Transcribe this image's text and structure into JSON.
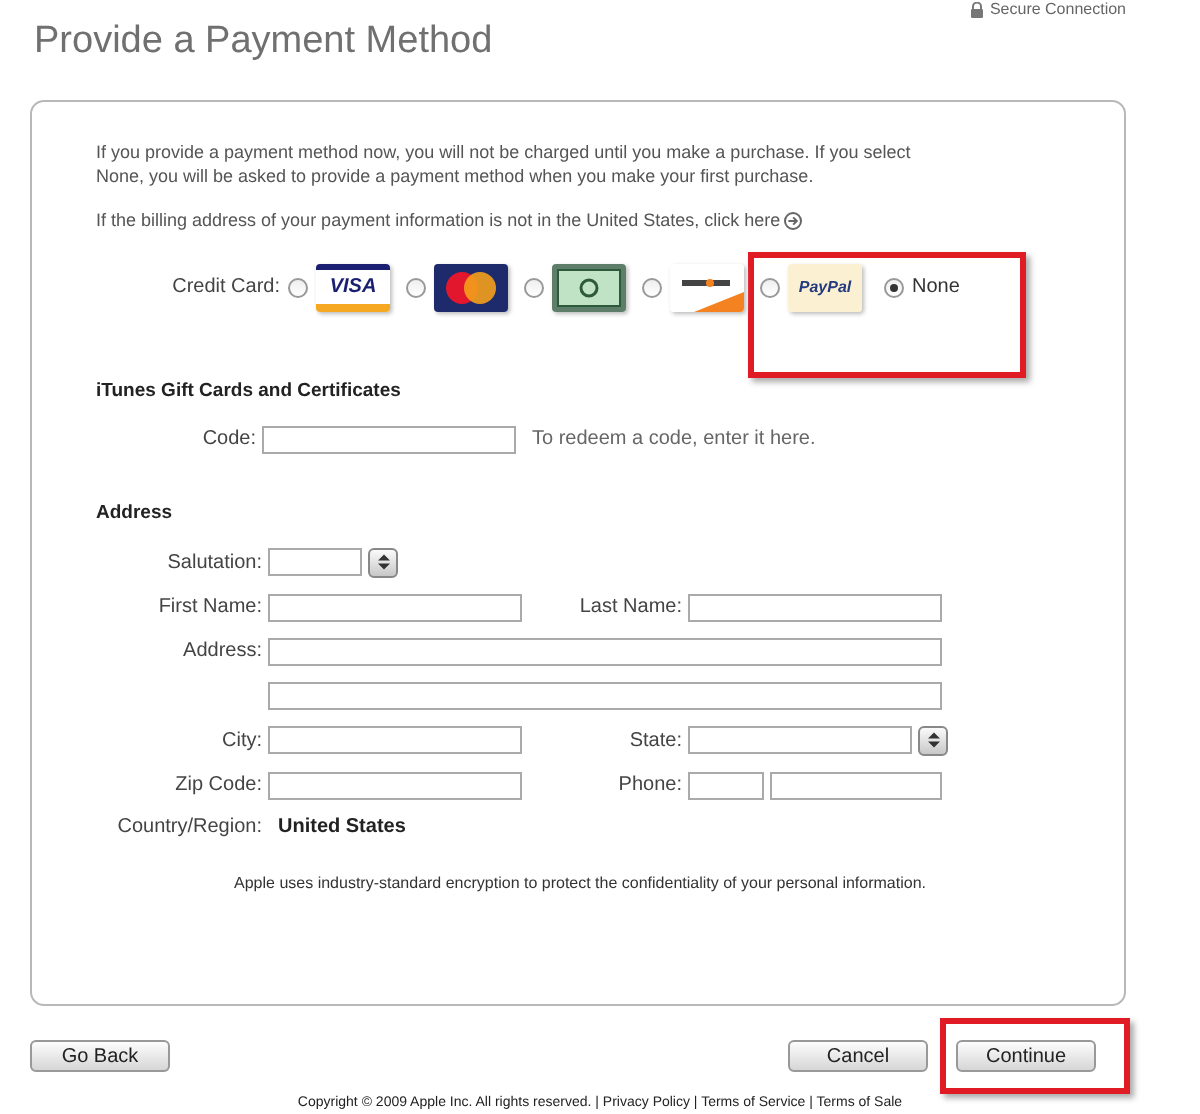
{
  "header": {
    "title": "Provide a Payment Method",
    "secure_label": "Secure Connection"
  },
  "intro": [
    "If you provide a payment method now, you will not be charged until you make a purchase. If you select None, you will be asked to provide a payment method when you make your first purchase."
  ],
  "billing_note": "If the billing address of your payment information is not in the United States, click here",
  "payment": {
    "label": "Credit Card:",
    "options": [
      {
        "kind": "visa",
        "logo_text": "VISA",
        "selected": false,
        "highlighted": false
      },
      {
        "kind": "mastercard",
        "selected": false,
        "highlighted": false
      },
      {
        "kind": "amex",
        "selected": false,
        "highlighted": false
      },
      {
        "kind": "discover",
        "selected": false,
        "highlighted": false
      },
      {
        "kind": "paypal",
        "logo_text": "PayPal",
        "selected": false,
        "highlighted": true
      },
      {
        "kind": "none",
        "label": "None",
        "selected": true,
        "highlighted": true
      }
    ]
  },
  "gift": {
    "heading": "iTunes Gift Cards and Certificates",
    "code_label": "Code:",
    "hint": "To redeem a code, enter it here."
  },
  "address": {
    "heading": "Address",
    "rows": [
      {
        "cells": [
          {
            "kind": "select",
            "label": "Salutation:"
          }
        ]
      },
      {
        "cells": [
          {
            "kind": "text",
            "label": "First Name:"
          },
          {
            "kind": "text",
            "label": "Last Name:"
          }
        ]
      },
      {
        "cells": [
          {
            "kind": "wide",
            "label": "Address:"
          }
        ]
      },
      {
        "cells": [
          {
            "kind": "wide"
          }
        ]
      },
      {
        "cells": [
          {
            "kind": "text",
            "label": "City:"
          },
          {
            "kind": "select",
            "label": "State:"
          }
        ]
      },
      {
        "cells": [
          {
            "kind": "text",
            "label": "Zip Code:"
          },
          {
            "kind": "phone",
            "label": "Phone:"
          }
        ]
      },
      {
        "cells": [
          {
            "kind": "static",
            "label": "Country/Region:",
            "value": "United States"
          }
        ]
      }
    ]
  },
  "encryption_note": "Apple uses industry-standard encryption to protect the confidentiality of your personal information.",
  "buttons": [
    {
      "label": "Go Back",
      "highlighted": false
    },
    {
      "label": "Cancel",
      "highlighted": false
    },
    {
      "label": "Continue",
      "highlighted": true
    }
  ],
  "footer": "Copyright © 2009 Apple Inc. All rights reserved. | Privacy Policy | Terms of Service | Terms of Sale"
}
